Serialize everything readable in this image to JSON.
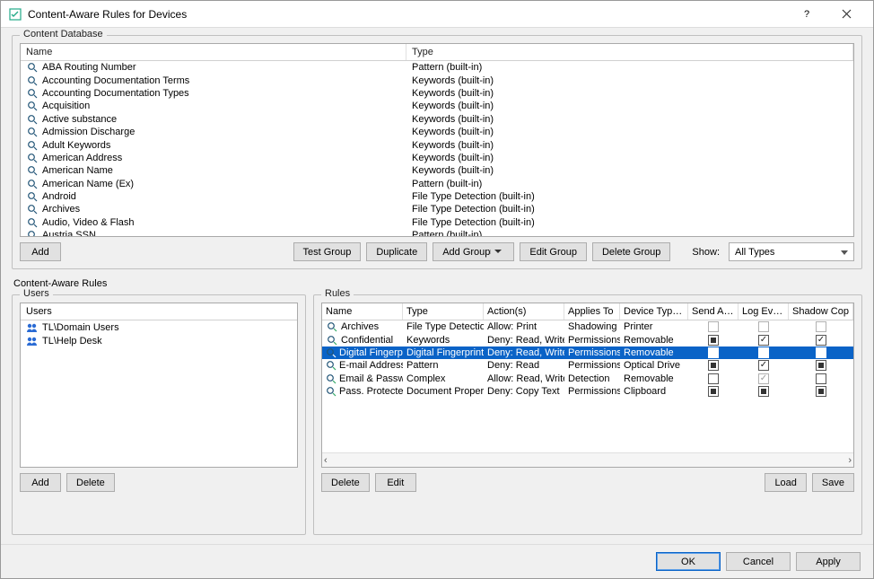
{
  "window": {
    "title": "Content-Aware Rules for Devices",
    "help_icon": "?",
    "close_icon": "×"
  },
  "content_db": {
    "legend": "Content Database",
    "columns": {
      "name": "Name",
      "type": "Type"
    },
    "rows": [
      {
        "name": "ABA Routing Number",
        "type": "Pattern (built-in)"
      },
      {
        "name": "Accounting Documentation Terms",
        "type": "Keywords (built-in)"
      },
      {
        "name": "Accounting Documentation Types",
        "type": "Keywords (built-in)"
      },
      {
        "name": "Acquisition",
        "type": "Keywords (built-in)"
      },
      {
        "name": "Active substance",
        "type": "Keywords (built-in)"
      },
      {
        "name": "Admission Discharge",
        "type": "Keywords (built-in)"
      },
      {
        "name": "Adult Keywords",
        "type": "Keywords (built-in)"
      },
      {
        "name": "American Address",
        "type": "Keywords (built-in)"
      },
      {
        "name": "American Name",
        "type": "Keywords (built-in)"
      },
      {
        "name": "American Name (Ex)",
        "type": "Pattern (built-in)"
      },
      {
        "name": "Android",
        "type": "File Type Detection (built-in)"
      },
      {
        "name": "Archives",
        "type": "File Type Detection (built-in)"
      },
      {
        "name": "Audio, Video & Flash",
        "type": "File Type Detection (built-in)"
      },
      {
        "name": "Austria SSN",
        "type": "Pattern (built-in)"
      }
    ],
    "buttons": {
      "add": "Add",
      "test_group": "Test Group",
      "duplicate": "Duplicate",
      "add_group": "Add Group",
      "edit_group": "Edit Group",
      "delete_group": "Delete Group",
      "show_label": "Show:",
      "show_value": "All Types"
    }
  },
  "car_label": "Content-Aware Rules",
  "users": {
    "legend": "Users",
    "header": "Users",
    "items": [
      {
        "name": "TL\\Domain Users"
      },
      {
        "name": "TL\\Help Desk"
      }
    ],
    "buttons": {
      "add": "Add",
      "delete": "Delete"
    }
  },
  "rules": {
    "legend": "Rules",
    "columns": {
      "name": "Name",
      "type": "Type",
      "actions": "Action(s)",
      "applies": "Applies To",
      "device": "Device Type(s)",
      "send_alert": "Send Alert",
      "log_event": "Log Event",
      "shadow_copy": "Shadow Cop"
    },
    "rows": [
      {
        "name": "Archives",
        "type": "File Type Detection",
        "actions": "Allow: Print",
        "applies": "Shadowing",
        "device": "Printer",
        "sa": "empty-dis",
        "le": "empty-dis",
        "sc": "empty-dis",
        "sel": false
      },
      {
        "name": "Confidential",
        "type": "Keywords",
        "actions": "Deny: Read, Write",
        "applies": "Permissions",
        "device": "Removable",
        "sa": "fill",
        "le": "check",
        "sc": "check",
        "sel": false
      },
      {
        "name": "Digital Fingerprints",
        "type": "Digital Fingerprints",
        "actions": "Deny: Read, Write",
        "applies": "Permissions",
        "device": "Removable",
        "sa": "fill",
        "le": "fill",
        "sc": "fill",
        "sel": true
      },
      {
        "name": "E-mail Address",
        "type": "Pattern",
        "actions": "Deny: Read",
        "applies": "Permissions",
        "device": "Optical Drive",
        "sa": "fill",
        "le": "check",
        "sc": "fill",
        "sel": false
      },
      {
        "name": "Email & Passwords",
        "type": "Complex",
        "actions": "Allow: Read, Write",
        "applies": "Detection",
        "device": "Removable",
        "sa": "empty",
        "le": "check-dis",
        "sc": "empty",
        "sel": false
      },
      {
        "name": "Pass. Protected",
        "type": "Document Propert…",
        "actions": "Deny: Copy Text",
        "applies": "Permissions",
        "device": "Clipboard",
        "sa": "fill",
        "le": "fill",
        "sc": "fill",
        "sel": false
      }
    ],
    "buttons": {
      "delete": "Delete",
      "edit": "Edit",
      "load": "Load",
      "save": "Save"
    }
  },
  "footer": {
    "ok": "OK",
    "cancel": "Cancel",
    "apply": "Apply"
  }
}
